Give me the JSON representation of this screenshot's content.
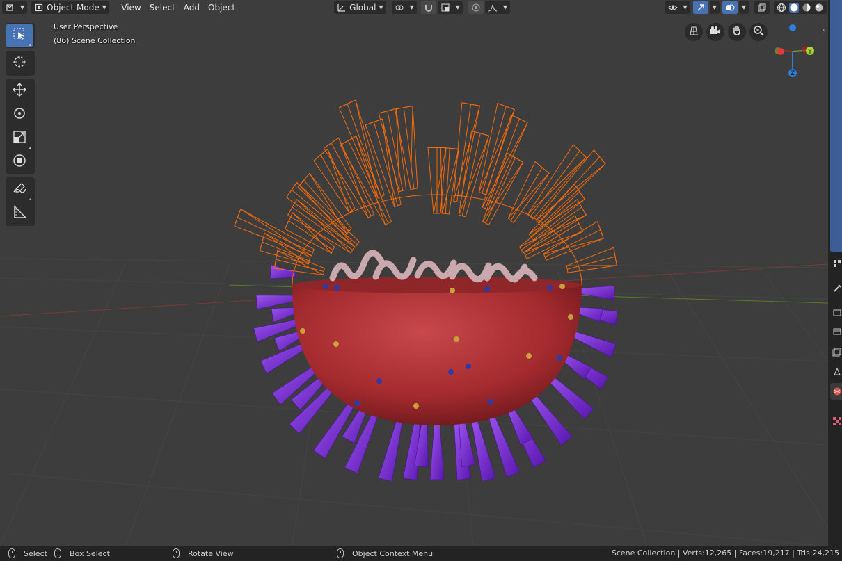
{
  "header": {
    "mode_label": "Object Mode",
    "menus": [
      "View",
      "Select",
      "Add",
      "Object"
    ],
    "transform_orientation": "Global"
  },
  "viewport": {
    "perspective_label": "User Perspective",
    "collection_label": "(86) Scene Collection",
    "gizmo_axes": {
      "y": "Y",
      "z": "Z"
    }
  },
  "colors": {
    "accent": "#4772b3",
    "wireframe": "#f26a0d",
    "body": "#a32a2e",
    "spike": "#7a2ad8"
  },
  "icons": {
    "tools": [
      "select-box-icon",
      "cursor-icon",
      "move-icon",
      "rotate-icon",
      "scale-icon",
      "transform-icon",
      "annotate-icon",
      "measure-icon"
    ],
    "nav": [
      "grid-view-icon",
      "camera-icon",
      "hand-pan-icon",
      "zoom-icon"
    ]
  },
  "status": {
    "select": "Select",
    "box_select": "Box Select",
    "rotate_view": "Rotate View",
    "context_menu": "Object Context Menu",
    "stats": "Scene Collection | Verts:12,265 | Faces:19,217 | Tris:24,215"
  }
}
